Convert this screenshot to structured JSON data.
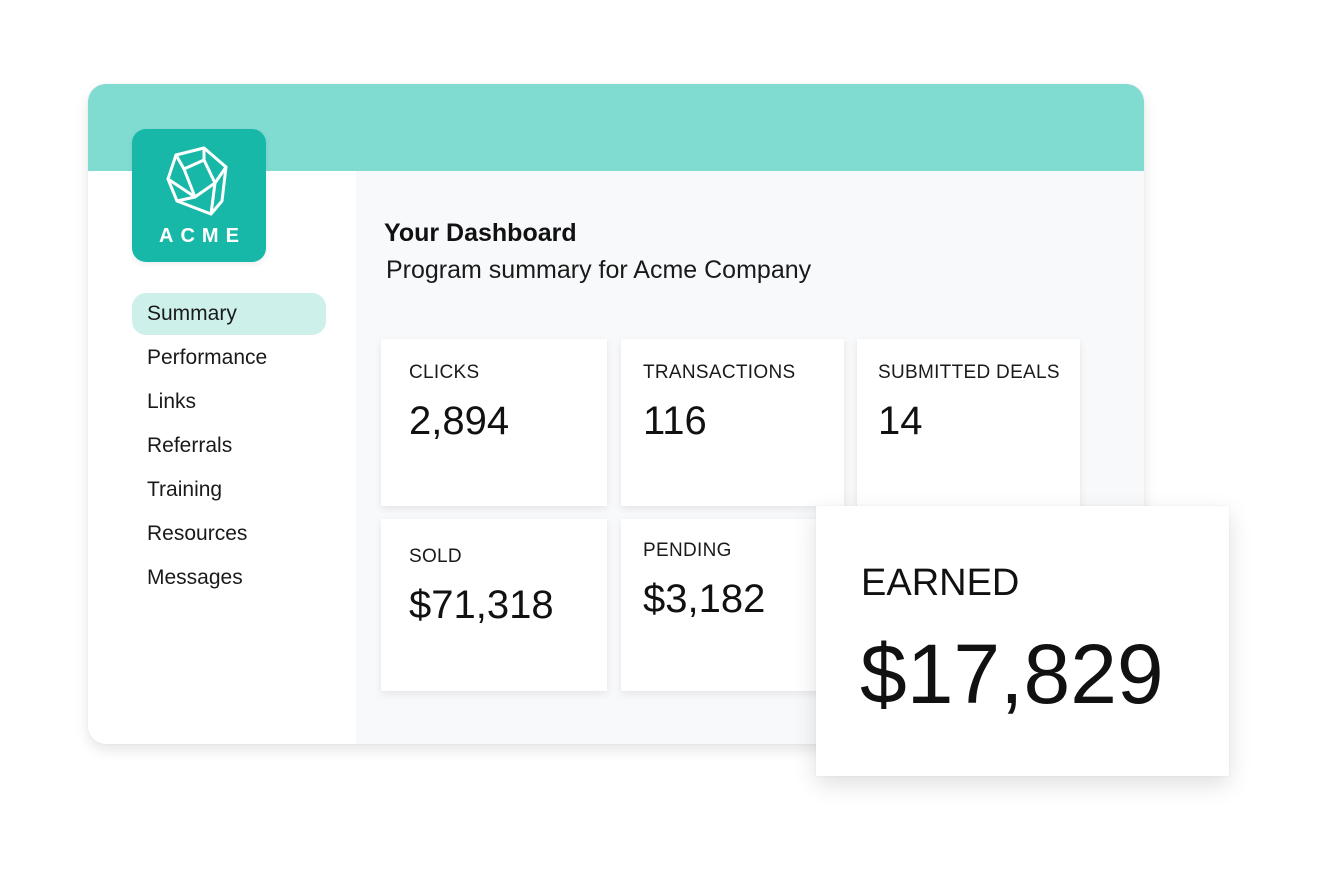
{
  "logo": {
    "text": "ACME",
    "icon": "cube-icon",
    "color": "#18b8a8"
  },
  "colors": {
    "header": "#80dbd1",
    "accent": "#18b8a8",
    "active_nav": "#cdf0eb"
  },
  "nav": {
    "items": [
      {
        "label": "Summary",
        "active": true
      },
      {
        "label": "Performance"
      },
      {
        "label": "Links"
      },
      {
        "label": "Referrals"
      },
      {
        "label": "Training"
      },
      {
        "label": "Resources"
      },
      {
        "label": "Messages"
      }
    ]
  },
  "dashboard": {
    "title": "Your Dashboard",
    "subtitle": "Program summary for Acme Company"
  },
  "stats": {
    "clicks": {
      "label": "CLICKS",
      "value": "2,894"
    },
    "transactions": {
      "label": "TRANSACTIONS",
      "value": "116"
    },
    "submitted_deals": {
      "label": "SUBMITTED DEALS",
      "value": "14"
    },
    "sold": {
      "label": "SOLD",
      "value": "$71,318"
    },
    "pending": {
      "label": "PENDING",
      "value": "$3,182"
    },
    "earned": {
      "label": "EARNED",
      "value": "$17,829"
    }
  }
}
